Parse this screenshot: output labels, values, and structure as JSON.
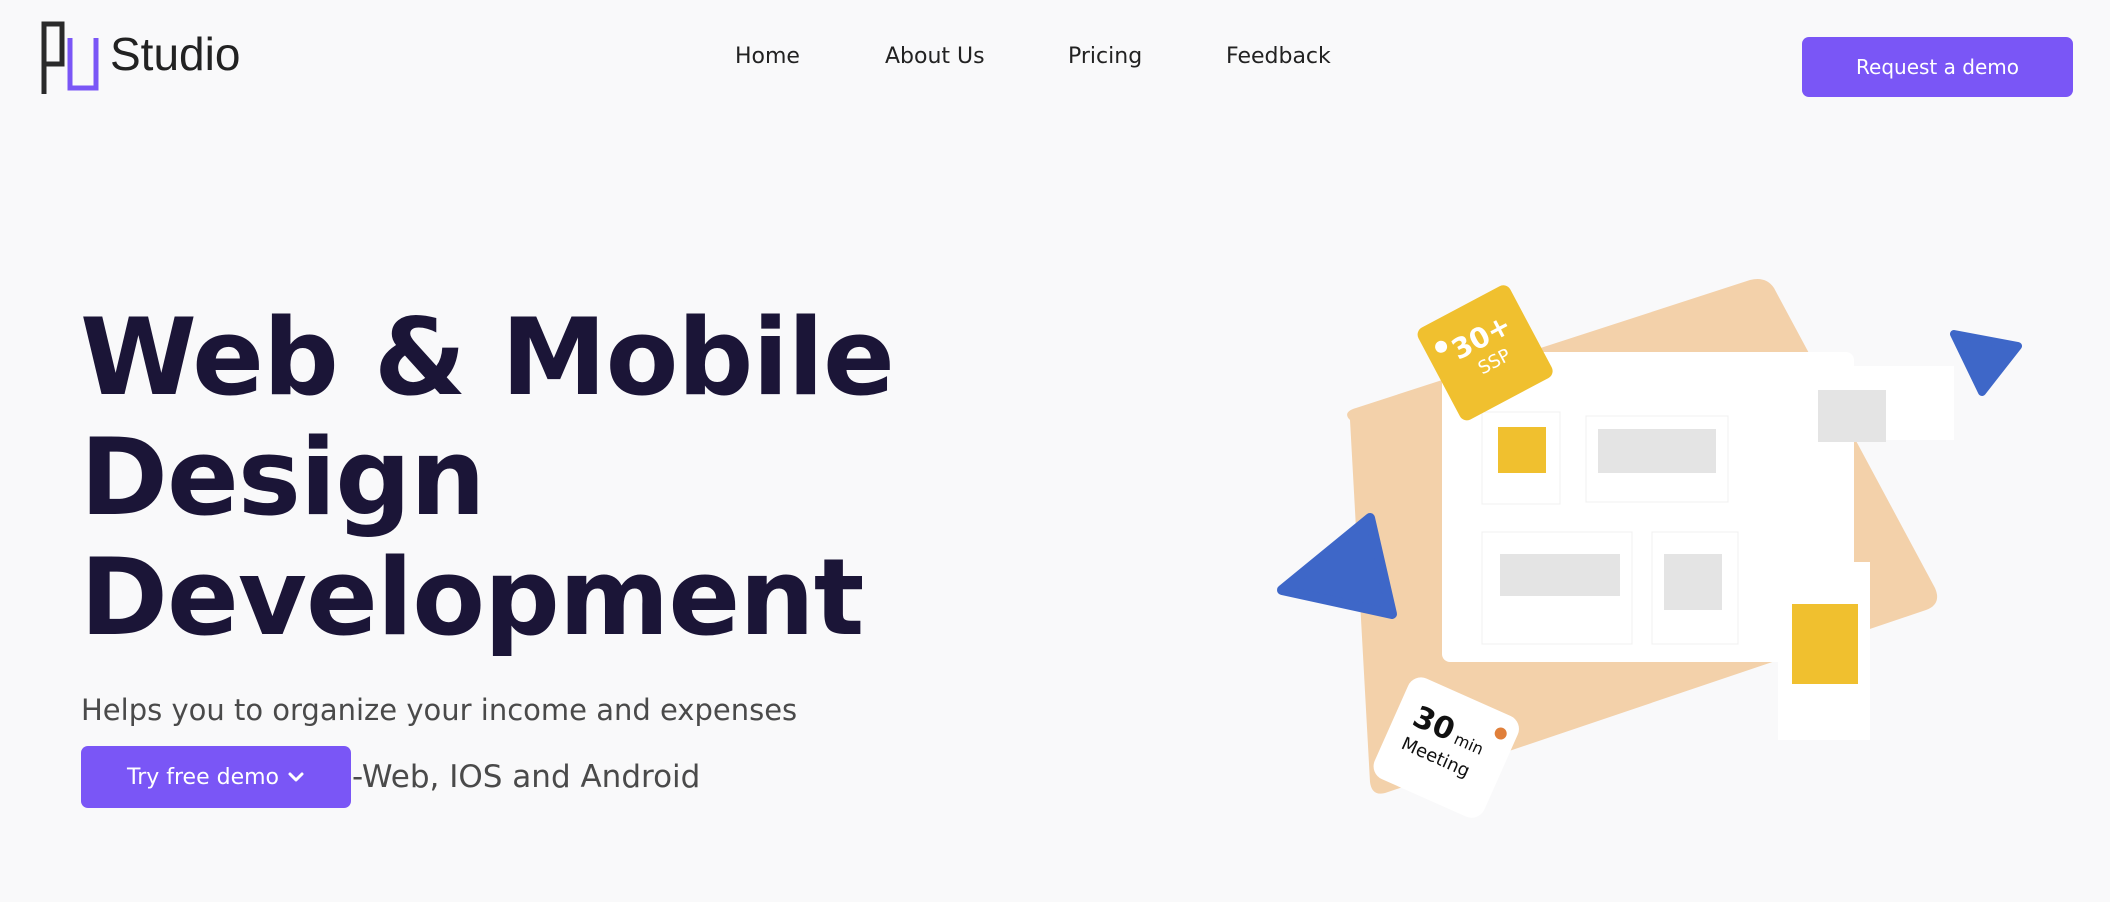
{
  "header": {
    "logo": {
      "mark_label": "PJ",
      "text": "Studio"
    },
    "nav": [
      {
        "label": "Home"
      },
      {
        "label": "About Us"
      },
      {
        "label": "Pricing"
      },
      {
        "label": "Feedback"
      }
    ],
    "cta_label": "Request a demo"
  },
  "hero": {
    "title_lines": [
      "Web & Mobile",
      "Design",
      "Development"
    ],
    "subtitle": "Helps you to organize your income and expenses",
    "try_label": "Try free demo",
    "platforms": "-Web, IOS and Android"
  },
  "illustration": {
    "badge_top": {
      "value": "30+",
      "caption": "SSP"
    },
    "badge_bottom": {
      "value": "30",
      "unit": "min",
      "caption": "Meeting"
    }
  },
  "colors": {
    "accent": "#7a56f6",
    "title": "#1b1537",
    "peach": "#f3d1aa",
    "yellow": "#f0c02f",
    "blue": "#3e67c8",
    "orange_dot": "#e07f3a"
  },
  "icons": {
    "try_button": "chevron-down-icon"
  }
}
